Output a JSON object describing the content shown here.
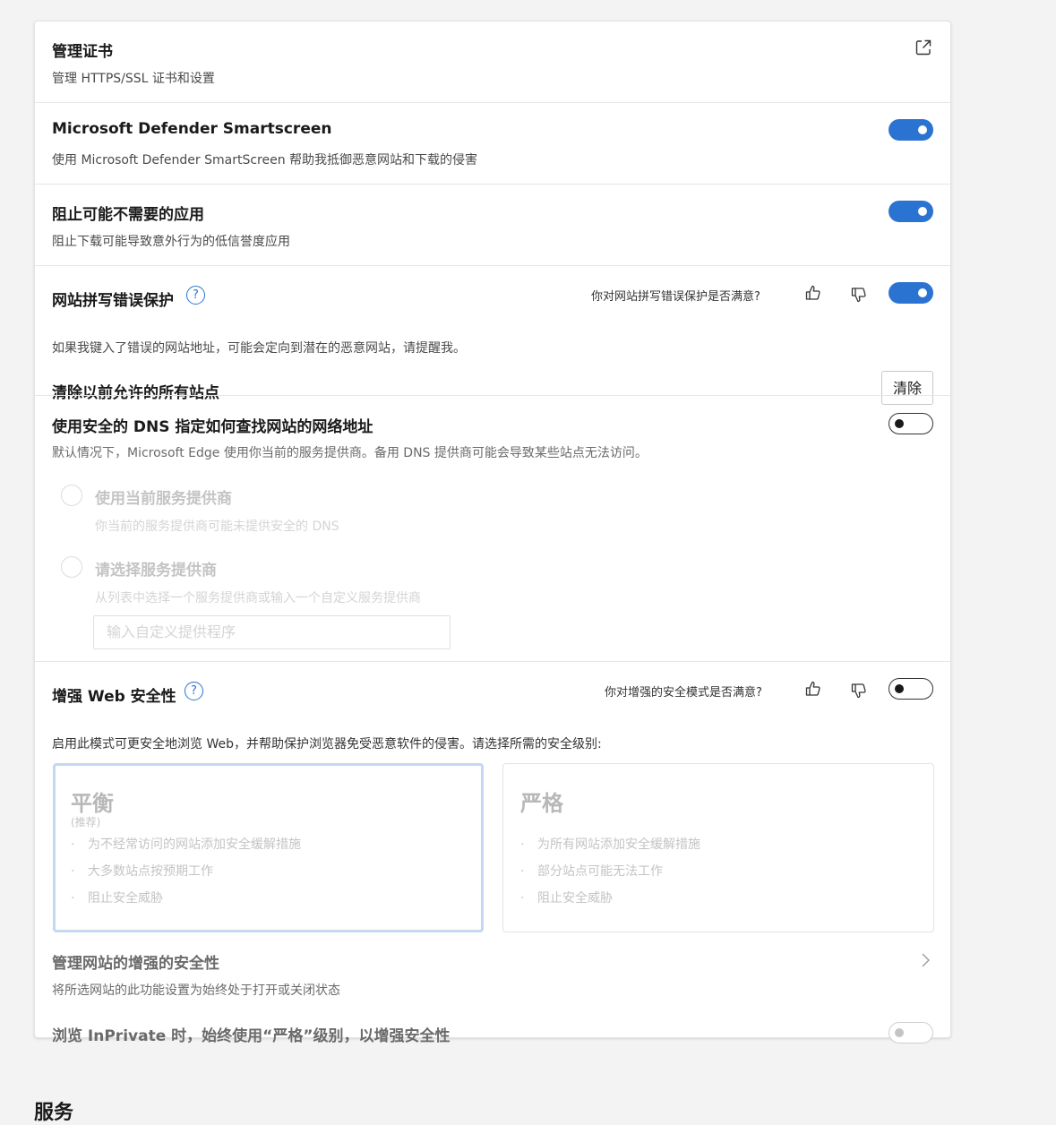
{
  "manage_certs": {
    "title": "管理证书",
    "desc": "管理 HTTPS/SSL 证书和设置",
    "icon": "external-link-icon"
  },
  "smartscreen": {
    "title": "Microsoft Defender Smartscreen",
    "desc": "使用 Microsoft Defender SmartScreen 帮助我抵御恶意网站和下载的侵害",
    "enabled": true
  },
  "pua": {
    "title": "阻止可能不需要的应用",
    "desc": "阻止下载可能导致意外行为的低信誉度应用",
    "enabled": true
  },
  "typo": {
    "title": "网站拼写错误保护",
    "help": "?",
    "feedback": "你对网站拼写错误保护是否满意?",
    "desc": "如果我键入了错误的网站地址，可能会定向到潜在的恶意网站，请提醒我。",
    "enabled": true,
    "clear_title": "清除以前允许的所有站点",
    "clear_button": "清除"
  },
  "dns": {
    "title": "使用安全的 DNS 指定如何查找网站的网络地址",
    "desc": "默认情况下，Microsoft Edge 使用你当前的服务提供商。备用 DNS 提供商可能会导致某些站点无法访问。",
    "enabled": false,
    "option_current_label": "使用当前服务提供商",
    "option_current_desc": "你当前的服务提供商可能未提供安全的 DNS",
    "option_choose_label": "请选择服务提供商",
    "option_choose_desc": "从列表中选择一个服务提供商或输入一个自定义服务提供商",
    "custom_placeholder": "输入自定义提供程序"
  },
  "enhanced": {
    "title": "增强 Web 安全性",
    "help": "?",
    "feedback": "你对增强的安全模式是否满意?",
    "enabled": false,
    "desc": "启用此模式可更安全地浏览 Web，并帮助保护浏览器免受恶意软件的侵害。请选择所需的安全级别:",
    "balanced": {
      "title": "平衡",
      "sub": "(推荐)",
      "items": [
        "为不经常访问的网站添加安全缓解措施",
        "大多数站点按预期工作",
        "阻止安全威胁"
      ]
    },
    "strict": {
      "title": "严格",
      "items": [
        "为所有网站添加安全缓解措施",
        "部分站点可能无法工作",
        "阻止安全威胁"
      ]
    },
    "manage_title": "管理网站的增强的安全性",
    "manage_desc": "将所选网站的此功能设置为始终处于打开或关闭状态",
    "inprivate_title": "浏览 InPrivate 时，始终使用“严格”级别，以增强安全性",
    "inprivate_enabled": false
  },
  "next_section": "服务",
  "colors": {
    "accent": "#2b73d1",
    "card": "#ffffff",
    "background": "#f3f3f3"
  }
}
